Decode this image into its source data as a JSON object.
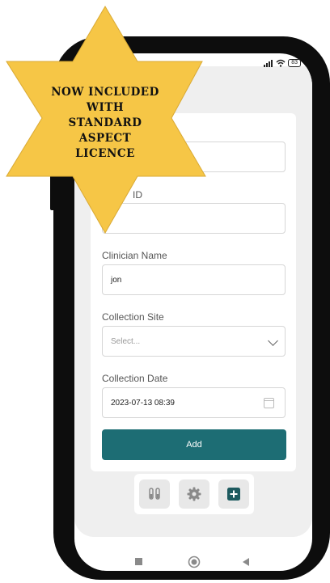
{
  "badge": {
    "lines": [
      "NOW INCLUDED",
      "WITH",
      "STANDARD",
      "ASPECT",
      "LICENCE"
    ]
  },
  "status_bar": {
    "battery": "83"
  },
  "form": {
    "id_label": "ID",
    "clinician_label": "Clinician Name",
    "clinician_value": "jon",
    "site_label": "Collection Site",
    "site_placeholder": "Select...",
    "date_label": "Collection Date",
    "date_value": "2023-07-13 08:39",
    "add_button": "Add"
  },
  "tabs": [
    {
      "icon": "test-tubes-icon"
    },
    {
      "icon": "gear-icon"
    },
    {
      "icon": "add-square-icon"
    }
  ],
  "nav_icons": [
    "square-icon",
    "circle-icon",
    "back-triangle-icon"
  ],
  "colors": {
    "accent": "#1d6d74",
    "badge": "#f6c646"
  }
}
